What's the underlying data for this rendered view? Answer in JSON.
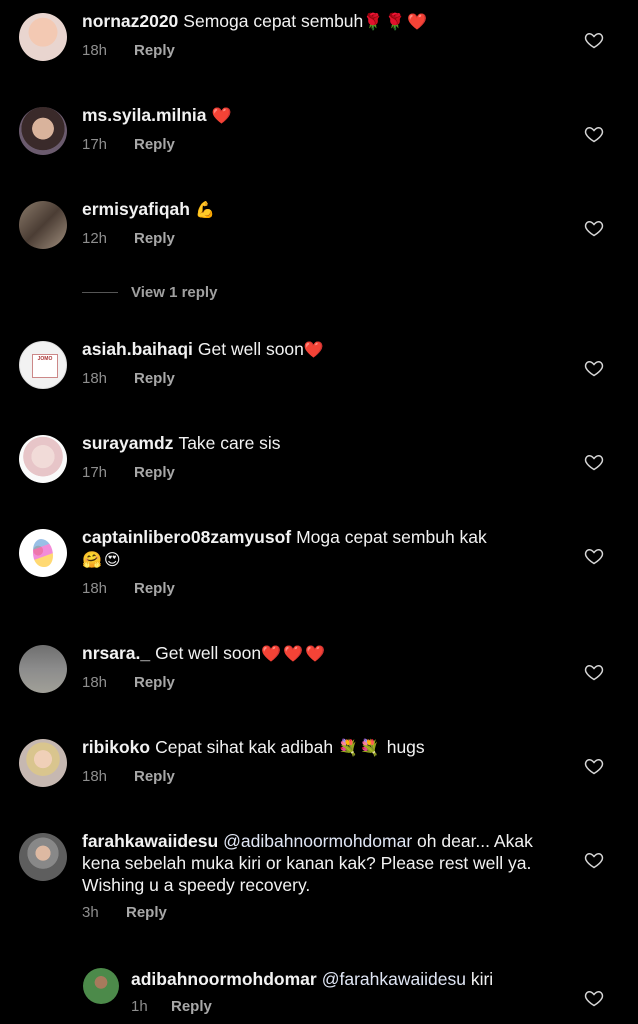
{
  "comments": [
    {
      "user": "nornaz2020",
      "text": "Semoga cepat sembuh",
      "emoji": "🌹🌹❤️",
      "time": "18h",
      "reply": "Reply"
    },
    {
      "user": "ms.syila.milnia",
      "text": "",
      "emoji": "❤️",
      "time": "17h",
      "reply": "Reply"
    },
    {
      "user": "ermisyafiqah",
      "text": "",
      "emoji": "💪",
      "time": "12h",
      "reply": "Reply"
    },
    {
      "user": "asiah.baihaqi",
      "text": "Get well soon",
      "emoji": "❤️",
      "time": "18h",
      "reply": "Reply"
    },
    {
      "user": "surayamdz",
      "text": "Take care sis",
      "emoji": "",
      "time": "17h",
      "reply": "Reply"
    },
    {
      "user": "captainlibero08zamyusof",
      "text": "Moga cepat sembuh kak",
      "emoji": "🤗😍",
      "time": "18h",
      "reply": "Reply"
    },
    {
      "user": "nrsara._",
      "text": "Get well soon",
      "emoji": "❤️❤️❤️",
      "time": "18h",
      "reply": "Reply"
    },
    {
      "user": "ribikoko",
      "text": "Cepat sihat kak adibah",
      "emoji": "💐💐",
      "text_after": "hugs",
      "time": "18h",
      "reply": "Reply"
    },
    {
      "user": "farahkawaiidesu",
      "mention": "@adibahnoormohdomar",
      "text": "oh dear... Akak kena sebelah muka kiri or kanan kak? Please rest well ya. Wishing u a speedy recovery.",
      "time": "3h",
      "reply": "Reply"
    }
  ],
  "view_replies": "View 1 reply",
  "nested_reply": {
    "user": "adibahnoormohdomar",
    "mention": "@farahkawaiidesu",
    "text": "kiri",
    "time": "1h",
    "reply": "Reply"
  },
  "avatar_4_card": "JOMO",
  "icons": {
    "like": "heart-outline-icon"
  },
  "colors": {
    "background": "#000000",
    "text": "#f2f2f2",
    "secondary": "#8e8e8e"
  }
}
